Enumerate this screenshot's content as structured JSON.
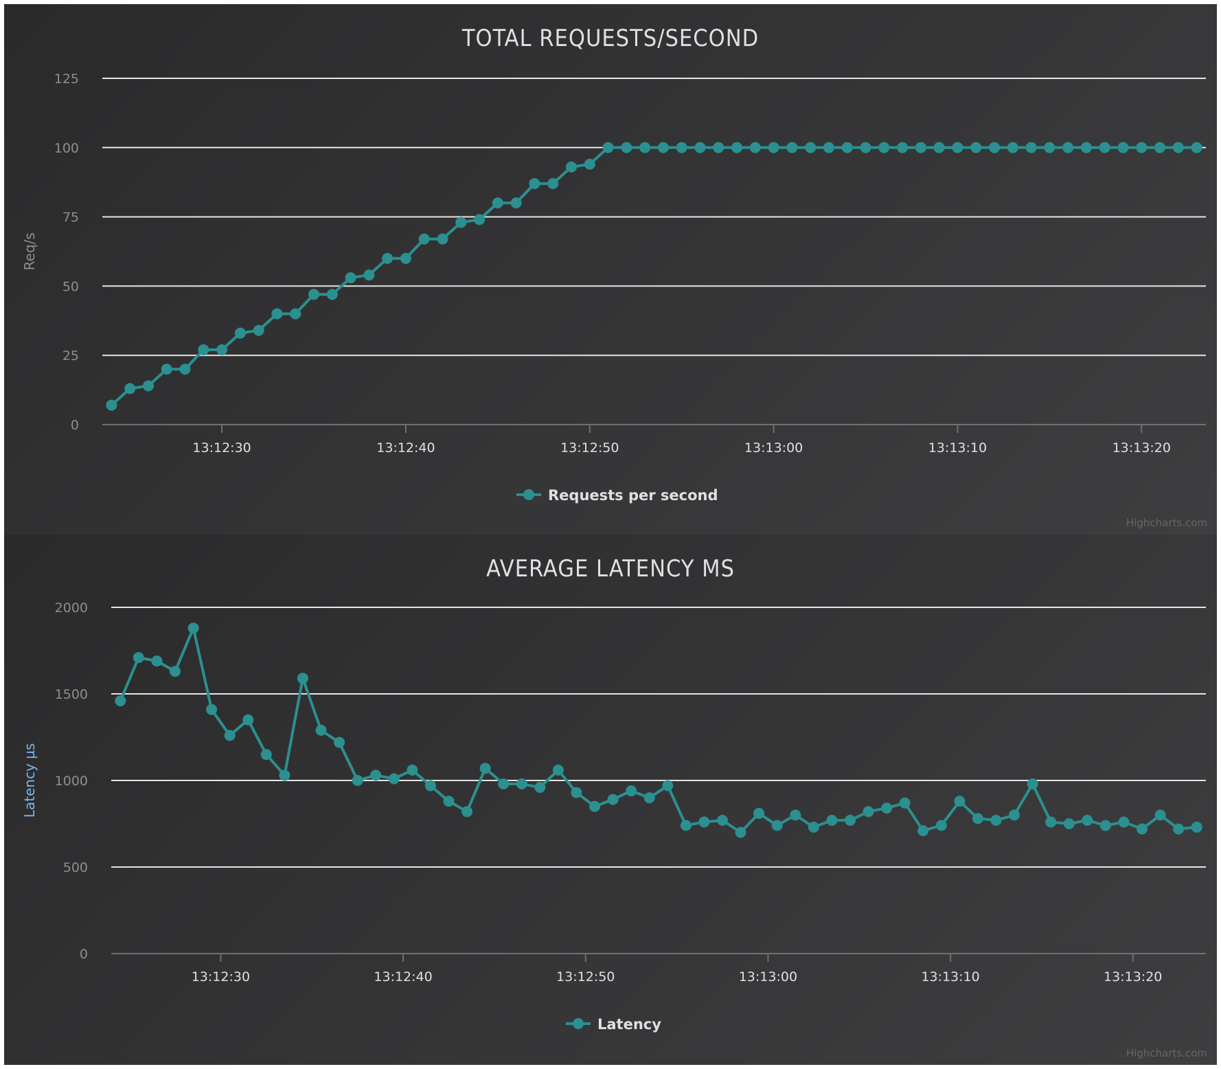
{
  "colors": {
    "series": "#2b908f",
    "latency_axis_title": "#7cb5ec",
    "rps_axis_title": "#8e8e90"
  },
  "credits": "Highcharts.com",
  "chart_data": [
    {
      "type": "line",
      "title": "TOTAL REQUESTS/SECOND",
      "ylabel": "Req/s",
      "ylim": [
        0,
        125
      ],
      "yticks": [
        0,
        25,
        50,
        75,
        100,
        125
      ],
      "xlim": [
        "13:12:23.5",
        "13:13:23.5"
      ],
      "xticks": [
        "13:12:30",
        "13:12:40",
        "13:12:50",
        "13:13:00",
        "13:13:10",
        "13:13:20"
      ],
      "grid": true,
      "legend_position": "bottom-center",
      "x": [
        "13:12:24",
        "13:12:25",
        "13:12:26",
        "13:12:27",
        "13:12:28",
        "13:12:29",
        "13:12:30",
        "13:12:31",
        "13:12:32",
        "13:12:33",
        "13:12:34",
        "13:12:35",
        "13:12:36",
        "13:12:37",
        "13:12:38",
        "13:12:39",
        "13:12:40",
        "13:12:41",
        "13:12:42",
        "13:12:43",
        "13:12:44",
        "13:12:45",
        "13:12:46",
        "13:12:47",
        "13:12:48",
        "13:12:49",
        "13:12:50",
        "13:12:51",
        "13:12:52",
        "13:12:53",
        "13:12:54",
        "13:12:55",
        "13:12:56",
        "13:12:57",
        "13:12:58",
        "13:12:59",
        "13:13:00",
        "13:13:01",
        "13:13:02",
        "13:13:03",
        "13:13:04",
        "13:13:05",
        "13:13:06",
        "13:13:07",
        "13:13:08",
        "13:13:09",
        "13:13:10",
        "13:13:11",
        "13:13:12",
        "13:13:13",
        "13:13:14",
        "13:13:15",
        "13:13:16",
        "13:13:17",
        "13:13:18",
        "13:13:19",
        "13:13:20",
        "13:13:21",
        "13:13:22",
        "13:13:23"
      ],
      "series": [
        {
          "name": "Requests per second",
          "values": [
            7,
            13,
            14,
            20,
            20,
            27,
            27,
            33,
            34,
            40,
            40,
            47,
            47,
            53,
            54,
            60,
            60,
            67,
            67,
            73,
            74,
            80,
            80,
            87,
            87,
            93,
            94,
            100,
            100,
            100,
            100,
            100,
            100,
            100,
            100,
            100,
            100,
            100,
            100,
            100,
            100,
            100,
            100,
            100,
            100,
            100,
            100,
            100,
            100,
            100,
            100,
            100,
            100,
            100,
            100,
            100,
            100,
            100,
            100,
            100
          ]
        }
      ]
    },
    {
      "type": "line",
      "title": "AVERAGE LATENCY MS",
      "ylabel": "Latency µs",
      "ylim": [
        0,
        2000
      ],
      "yticks": [
        0,
        500,
        1000,
        1500,
        2000
      ],
      "xlim": [
        "13:12:24",
        "13:13:24"
      ],
      "xticks": [
        "13:12:30",
        "13:12:40",
        "13:12:50",
        "13:13:00",
        "13:13:10",
        "13:13:20"
      ],
      "grid": true,
      "legend_position": "bottom-center",
      "x": [
        "13:12:24.5",
        "13:12:25.5",
        "13:12:26.5",
        "13:12:27.5",
        "13:12:28.5",
        "13:12:29.5",
        "13:12:30.5",
        "13:12:31.5",
        "13:12:32.5",
        "13:12:33.5",
        "13:12:34.5",
        "13:12:35.5",
        "13:12:36.5",
        "13:12:37.5",
        "13:12:38.5",
        "13:12:39.5",
        "13:12:40.5",
        "13:12:41.5",
        "13:12:42.5",
        "13:12:43.5",
        "13:12:44.5",
        "13:12:45.5",
        "13:12:46.5",
        "13:12:47.5",
        "13:12:48.5",
        "13:12:49.5",
        "13:12:50.5",
        "13:12:51.5",
        "13:12:52.5",
        "13:12:53.5",
        "13:12:54.5",
        "13:12:55.5",
        "13:12:56.5",
        "13:12:57.5",
        "13:12:58.5",
        "13:12:59.5",
        "13:13:00.5",
        "13:13:01.5",
        "13:13:02.5",
        "13:13:03.5",
        "13:13:04.5",
        "13:13:05.5",
        "13:13:06.5",
        "13:13:07.5",
        "13:13:08.5",
        "13:13:09.5",
        "13:13:10.5",
        "13:13:11.5",
        "13:13:12.5",
        "13:13:13.5",
        "13:13:14.5",
        "13:13:15.5",
        "13:13:16.5",
        "13:13:17.5",
        "13:13:18.5",
        "13:13:19.5",
        "13:13:20.5",
        "13:13:21.5",
        "13:13:22.5",
        "13:13:23.5"
      ],
      "series": [
        {
          "name": "Latency",
          "values": [
            1460,
            1710,
            1690,
            1630,
            1880,
            1410,
            1260,
            1350,
            1150,
            1030,
            1590,
            1290,
            1220,
            1000,
            1030,
            1010,
            1060,
            970,
            880,
            820,
            1070,
            980,
            980,
            960,
            1060,
            930,
            850,
            890,
            940,
            900,
            970,
            740,
            760,
            770,
            700,
            810,
            740,
            800,
            730,
            770,
            770,
            820,
            840,
            870,
            710,
            740,
            880,
            780,
            770,
            800,
            980,
            760,
            750,
            770,
            740,
            760,
            720,
            800,
            720,
            730
          ]
        }
      ]
    }
  ]
}
